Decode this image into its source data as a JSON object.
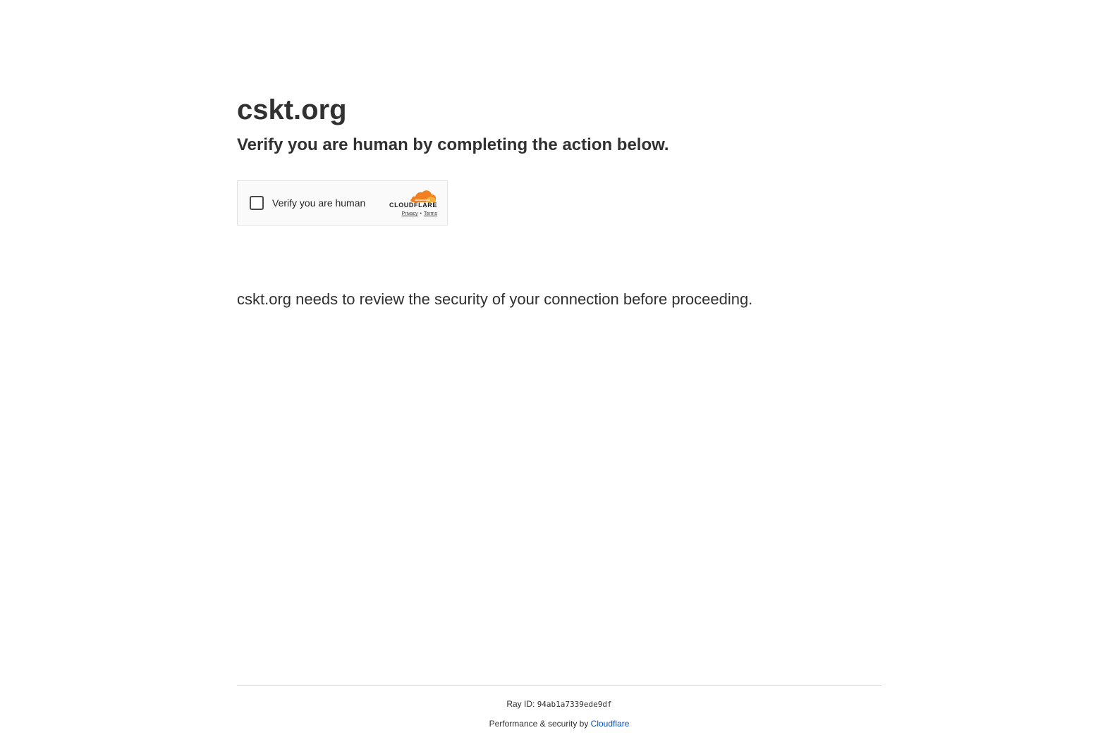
{
  "header": {
    "site_title": "cskt.org",
    "subtitle": "Verify you are human by completing the action below."
  },
  "widget": {
    "checkbox_label": "Verify you are human",
    "checked": false,
    "brand_name": "CLOUDFLARE",
    "privacy_link": "Privacy",
    "separator": "•",
    "terms_link": "Terms",
    "icon": "cloudflare-cloud-icon",
    "brand_color": "#f38020"
  },
  "main": {
    "description": "cskt.org needs to review the security of your connection before proceeding."
  },
  "footer": {
    "ray_label": "Ray ID:",
    "ray_id": "94ab1a7339ede9df",
    "perf_text": "Performance & security by",
    "perf_link": "Cloudflare",
    "link_color": "#0051c3"
  }
}
